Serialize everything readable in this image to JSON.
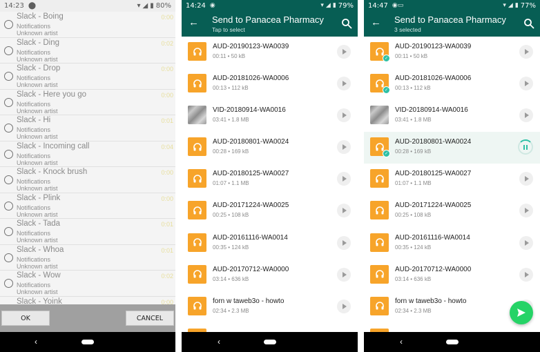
{
  "screen1": {
    "status": {
      "time": "14:23",
      "battery": "80%"
    },
    "items": [
      {
        "title": "Slack - Boing",
        "category": "Notifications",
        "artist": "Unknown artist",
        "duration": "0:00"
      },
      {
        "title": "Slack - Ding",
        "category": "Notifications",
        "artist": "Unknown artist",
        "duration": "0:02"
      },
      {
        "title": "Slack - Drop",
        "category": "Notifications",
        "artist": "Unknown artist",
        "duration": "0:00"
      },
      {
        "title": "Slack - Here you go",
        "category": "Notifications",
        "artist": "Unknown artist",
        "duration": "0:00"
      },
      {
        "title": "Slack - Hi",
        "category": "Notifications",
        "artist": "Unknown artist",
        "duration": "0:01"
      },
      {
        "title": "Slack - Incoming call",
        "category": "Notifications",
        "artist": "Unknown artist",
        "duration": "0:04"
      },
      {
        "title": "Slack - Knock brush",
        "category": "Notifications",
        "artist": "Unknown artist",
        "duration": "0:00"
      },
      {
        "title": "Slack - Plink",
        "category": "Notifications",
        "artist": "Unknown artist",
        "duration": "0:00"
      },
      {
        "title": "Slack - Tada",
        "category": "Notifications",
        "artist": "Unknown artist",
        "duration": "0:01"
      },
      {
        "title": "Slack - Whoa",
        "category": "Notifications",
        "artist": "Unknown artist",
        "duration": "0:01"
      },
      {
        "title": "Slack - Wow",
        "category": "Notifications",
        "artist": "Unknown artist",
        "duration": "0:02"
      },
      {
        "title": "Slack - Yoink",
        "category": "",
        "artist": "",
        "duration": "0:00"
      }
    ],
    "ok_label": "OK",
    "cancel_label": "CANCEL"
  },
  "screen2": {
    "status": {
      "time": "14:24",
      "battery": "79%"
    },
    "title": "Send to Panacea Pharmacy",
    "subtitle": "Tap to select",
    "files": [
      {
        "name": "AUD-20190123-WA0039",
        "meta": "00:11 • 50 kB",
        "type": "audio"
      },
      {
        "name": "AUD-20181026-WA0006",
        "meta": "00:13 • 112 kB",
        "type": "audio"
      },
      {
        "name": "VID-20180914-WA0016",
        "meta": "03:41 • 1.8 MB",
        "type": "video"
      },
      {
        "name": "AUD-20180801-WA0024",
        "meta": "00:28 • 169 kB",
        "type": "audio"
      },
      {
        "name": "AUD-20180125-WA0027",
        "meta": "01:07 • 1.1 MB",
        "type": "audio"
      },
      {
        "name": "AUD-20171224-WA0025",
        "meta": "00:25 • 108 kB",
        "type": "audio"
      },
      {
        "name": "AUD-20161116-WA0014",
        "meta": "00:35 • 124 kB",
        "type": "audio"
      },
      {
        "name": "AUD-20170712-WA0000",
        "meta": "03:14 • 636 kB",
        "type": "audio"
      },
      {
        "name": "forn w taweb3o - howto",
        "meta": "02:34 • 2.3 MB",
        "type": "audio"
      }
    ]
  },
  "screen3": {
    "status": {
      "time": "14:47",
      "battery": "77%"
    },
    "title": "Send to Panacea Pharmacy",
    "subtitle": "3 selected",
    "files": [
      {
        "name": "AUD-20190123-WA0039",
        "meta": "00:11 • 50 kB",
        "type": "audio",
        "selected": true,
        "playing": false
      },
      {
        "name": "AUD-20181026-WA0006",
        "meta": "00:13 • 112 kB",
        "type": "audio",
        "selected": true,
        "playing": false
      },
      {
        "name": "VID-20180914-WA0016",
        "meta": "03:41 • 1.8 MB",
        "type": "video",
        "selected": false,
        "playing": false
      },
      {
        "name": "AUD-20180801-WA0024",
        "meta": "00:28 • 169 kB",
        "type": "audio",
        "selected": true,
        "playing": true
      },
      {
        "name": "AUD-20180125-WA0027",
        "meta": "01:07 • 1.1 MB",
        "type": "audio",
        "selected": false,
        "playing": false
      },
      {
        "name": "AUD-20171224-WA0025",
        "meta": "00:25 • 108 kB",
        "type": "audio",
        "selected": false,
        "playing": false
      },
      {
        "name": "AUD-20161116-WA0014",
        "meta": "00:35 • 124 kB",
        "type": "audio",
        "selected": false,
        "playing": false
      },
      {
        "name": "AUD-20170712-WA0000",
        "meta": "03:14 • 636 kB",
        "type": "audio",
        "selected": false,
        "playing": false
      },
      {
        "name": "forn w taweb3o - howto",
        "meta": "02:34 • 2.3 MB",
        "type": "audio",
        "selected": false,
        "playing": false
      }
    ]
  },
  "colors": {
    "whatsapp_header": "#075e54",
    "audio_thumb": "#f7a42a",
    "fab": "#25d366",
    "check": "#2dc0a5"
  },
  "icons": {
    "back": "arrow-left-icon",
    "search": "search-icon",
    "headphones": "headphones-icon",
    "play": "play-icon",
    "pause": "pause-icon",
    "send": "send-icon"
  }
}
